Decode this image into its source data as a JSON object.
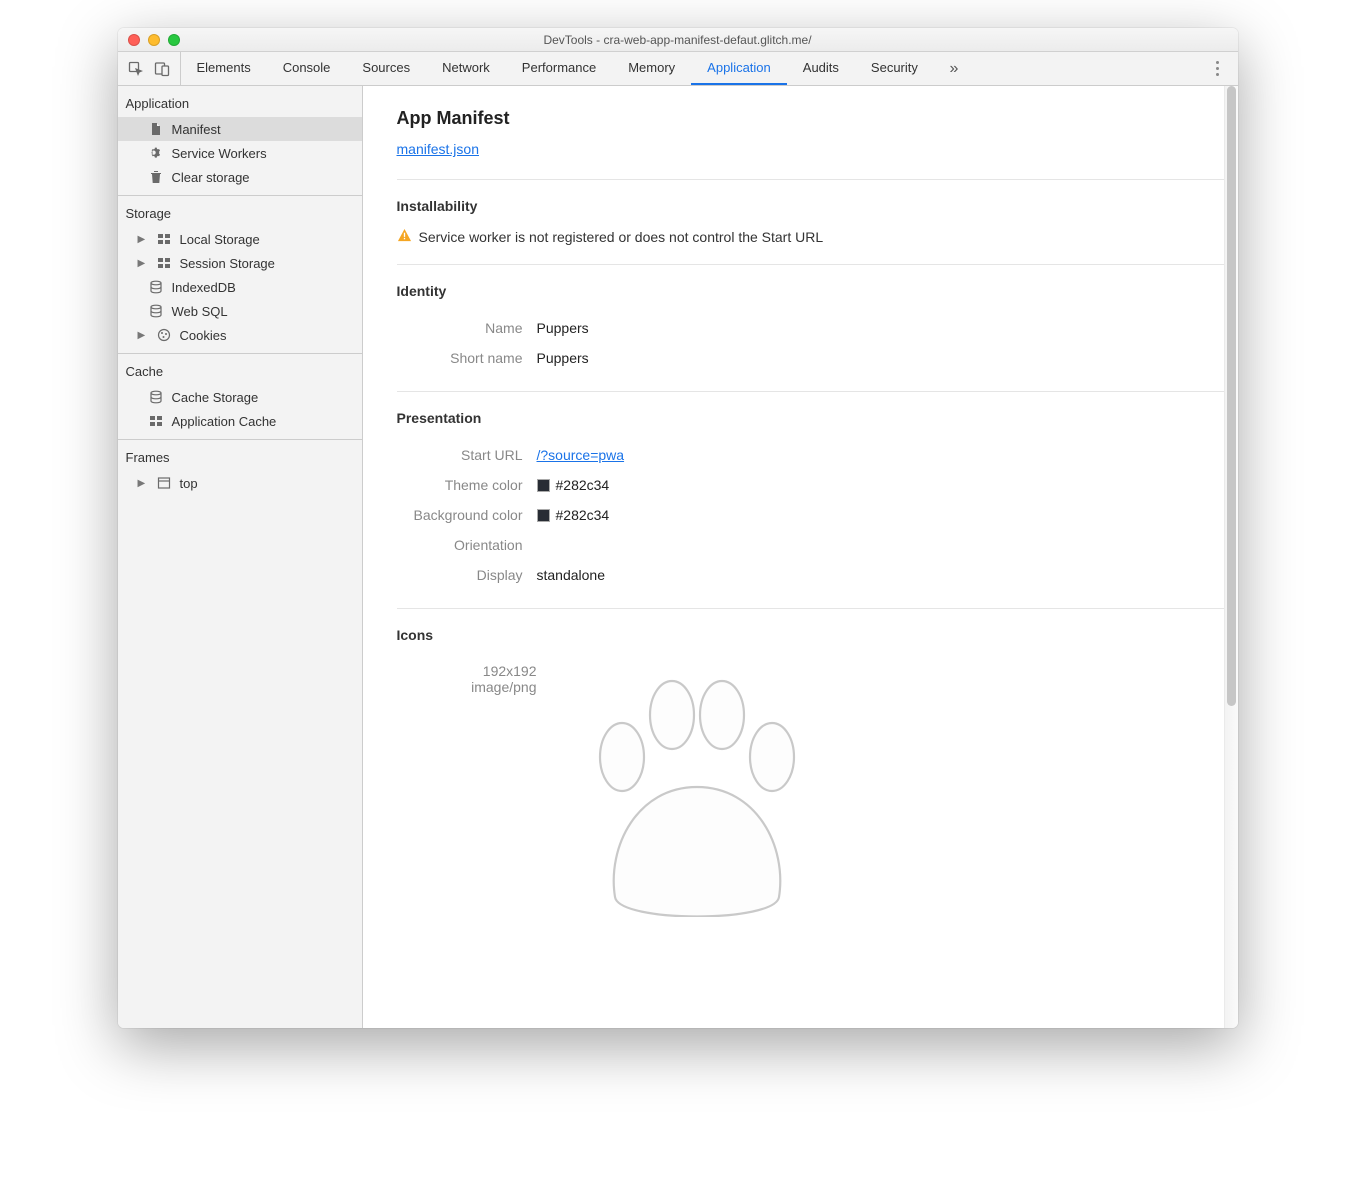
{
  "window": {
    "title": "DevTools - cra-web-app-manifest-defaut.glitch.me/"
  },
  "tabs": {
    "items": [
      {
        "label": "Elements",
        "active": false
      },
      {
        "label": "Console",
        "active": false
      },
      {
        "label": "Sources",
        "active": false
      },
      {
        "label": "Network",
        "active": false
      },
      {
        "label": "Performance",
        "active": false
      },
      {
        "label": "Memory",
        "active": false
      },
      {
        "label": "Application",
        "active": true
      },
      {
        "label": "Audits",
        "active": false
      },
      {
        "label": "Security",
        "active": false
      }
    ],
    "overflow_glyph": "»"
  },
  "sidebar": {
    "groups": [
      {
        "title": "Application",
        "items": [
          {
            "label": "Manifest",
            "icon": "file-icon",
            "active": true
          },
          {
            "label": "Service Workers",
            "icon": "gear-icon"
          },
          {
            "label": "Clear storage",
            "icon": "trash-icon"
          }
        ]
      },
      {
        "title": "Storage",
        "items": [
          {
            "label": "Local Storage",
            "icon": "grid-icon",
            "expandable": true
          },
          {
            "label": "Session Storage",
            "icon": "grid-icon",
            "expandable": true
          },
          {
            "label": "IndexedDB",
            "icon": "database-icon"
          },
          {
            "label": "Web SQL",
            "icon": "database-icon"
          },
          {
            "label": "Cookies",
            "icon": "cookie-icon",
            "expandable": true
          }
        ]
      },
      {
        "title": "Cache",
        "items": [
          {
            "label": "Cache Storage",
            "icon": "database-icon"
          },
          {
            "label": "Application Cache",
            "icon": "grid-icon"
          }
        ]
      },
      {
        "title": "Frames",
        "items": [
          {
            "label": "top",
            "icon": "frame-icon",
            "expandable": true
          }
        ]
      }
    ]
  },
  "main": {
    "heading": "App Manifest",
    "manifest_link": "manifest.json",
    "installability": {
      "title": "Installability",
      "warning": "Service worker is not registered or does not control the Start URL"
    },
    "identity": {
      "title": "Identity",
      "name_label": "Name",
      "name_value": "Puppers",
      "short_name_label": "Short name",
      "short_name_value": "Puppers"
    },
    "presentation": {
      "title": "Presentation",
      "start_url_label": "Start URL",
      "start_url_value": "/?source=pwa",
      "theme_color_label": "Theme color",
      "theme_color_value": "#282c34",
      "background_color_label": "Background color",
      "background_color_value": "#282c34",
      "orientation_label": "Orientation",
      "orientation_value": "",
      "display_label": "Display",
      "display_value": "standalone"
    },
    "icons": {
      "title": "Icons",
      "size": "192x192",
      "mime": "image/png"
    }
  }
}
